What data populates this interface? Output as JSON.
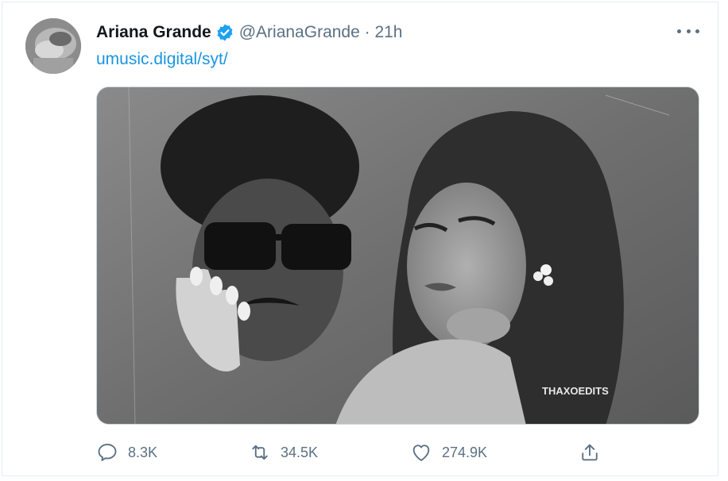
{
  "tweet": {
    "author_name": "Ariana Grande",
    "handle_time": "@ArianaGrande · 21h",
    "link_text": "umusic.digital/syt/",
    "media_watermark": "THAXOEDITS"
  },
  "actions": {
    "reply_count": "8.3K",
    "retweet_count": "34.5K",
    "like_count": "274.9K"
  },
  "icons": {
    "verified": "verified-badge-icon",
    "more": "more-horizontal-icon",
    "reply": "reply-icon",
    "retweet": "retweet-icon",
    "like": "heart-icon",
    "share": "share-icon"
  },
  "colors": {
    "verified_blue": "#1da1f2",
    "link_blue": "#1b95e0",
    "secondary_text": "#5b7083",
    "primary_text": "#14171a"
  }
}
